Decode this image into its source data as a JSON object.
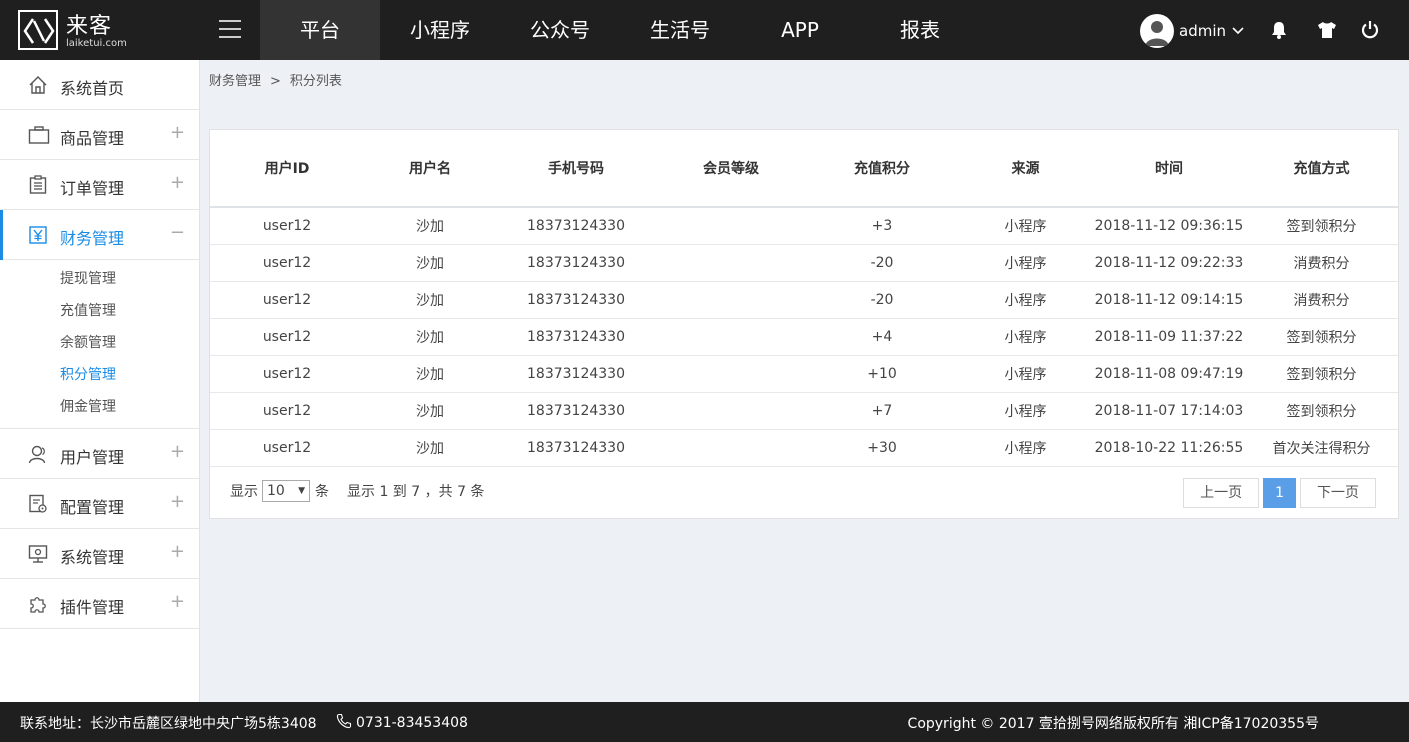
{
  "header": {
    "logo_cn": "来客",
    "logo_en": "laiketui.com",
    "nav": [
      "平台",
      "小程序",
      "公众号",
      "生活号",
      "APP",
      "报表"
    ],
    "active_nav": 0,
    "username": "admin"
  },
  "sidebar": {
    "items": [
      {
        "label": "系统首页",
        "icon": "home-icon",
        "toggle": ""
      },
      {
        "label": "商品管理",
        "icon": "briefcase-icon",
        "toggle": "+"
      },
      {
        "label": "订单管理",
        "icon": "clipboard-icon",
        "toggle": "+"
      },
      {
        "label": "财务管理",
        "icon": "yen-icon",
        "toggle": "−"
      },
      {
        "label": "用户管理",
        "icon": "user-icon",
        "toggle": "+"
      },
      {
        "label": "配置管理",
        "icon": "config-icon",
        "toggle": "+"
      },
      {
        "label": "系统管理",
        "icon": "monitor-icon",
        "toggle": "+"
      },
      {
        "label": "插件管理",
        "icon": "plugin-icon",
        "toggle": "+"
      }
    ],
    "finance_sub": [
      "提现管理",
      "充值管理",
      "余额管理",
      "积分管理",
      "佣金管理"
    ]
  },
  "breadcrumb": {
    "parent": "财务管理",
    "sep": ">",
    "current": "积分列表"
  },
  "table": {
    "columns": [
      "用户ID",
      "用户名",
      "手机号码",
      "会员等级",
      "充值积分",
      "来源",
      "时间",
      "充值方式"
    ],
    "rows": [
      [
        "user12",
        "沙加",
        "18373124330",
        "",
        "+3",
        "小程序",
        "2018-11-12 09:36:15",
        "签到领积分"
      ],
      [
        "user12",
        "沙加",
        "18373124330",
        "",
        "-20",
        "小程序",
        "2018-11-12 09:22:33",
        "消费积分"
      ],
      [
        "user12",
        "沙加",
        "18373124330",
        "",
        "-20",
        "小程序",
        "2018-11-12 09:14:15",
        "消费积分"
      ],
      [
        "user12",
        "沙加",
        "18373124330",
        "",
        "+4",
        "小程序",
        "2018-11-09 11:37:22",
        "签到领积分"
      ],
      [
        "user12",
        "沙加",
        "18373124330",
        "",
        "+10",
        "小程序",
        "2018-11-08 09:47:19",
        "签到领积分"
      ],
      [
        "user12",
        "沙加",
        "18373124330",
        "",
        "+7",
        "小程序",
        "2018-11-07 17:14:03",
        "签到领积分"
      ],
      [
        "user12",
        "沙加",
        "18373124330",
        "",
        "+30",
        "小程序",
        "2018-10-22 11:26:55",
        "首次关注得积分"
      ]
    ]
  },
  "pager": {
    "show_label": "显示",
    "page_size": "10",
    "unit_label": "条",
    "info": "显示 1 到 7 ，共 7 条",
    "prev": "上一页",
    "current": "1",
    "next": "下一页"
  },
  "footer": {
    "address": "联系地址：长沙市岳麓区绿地中央广场5栋3408",
    "phone": "0731-83453408",
    "copyright": "Copyright © 2017 壹拾捌号网络版权所有  湘ICP备17020355号"
  }
}
